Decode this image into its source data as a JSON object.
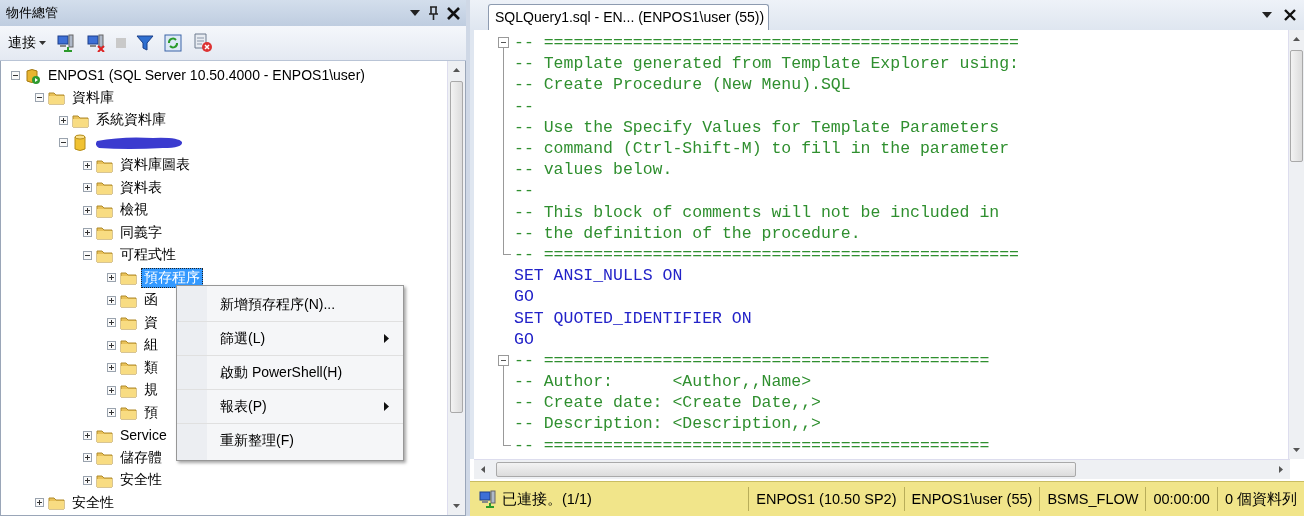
{
  "explorer": {
    "title": "物件總管",
    "toolbar": {
      "connect": "連接"
    },
    "tree": [
      {
        "kind": "server",
        "label": "ENPOS1 (SQL Server 10.50.4000 - ENPOS1\\user)",
        "expanded": true,
        "selected": false,
        "children": [
          {
            "kind": "folder",
            "label": "資料庫",
            "expanded": true,
            "selected": false,
            "children": [
              {
                "kind": "folder",
                "label": "系統資料庫",
                "expanded": false,
                "selected": false
              },
              {
                "kind": "database",
                "redacted": true,
                "expanded": true,
                "selected": false,
                "children": [
                  {
                    "kind": "folder",
                    "label": "資料庫圖表",
                    "expanded": false,
                    "selected": false
                  },
                  {
                    "kind": "folder",
                    "label": "資料表",
                    "expanded": false,
                    "selected": false
                  },
                  {
                    "kind": "folder",
                    "label": "檢視",
                    "expanded": false,
                    "selected": false
                  },
                  {
                    "kind": "folder",
                    "label": "同義字",
                    "expanded": false,
                    "selected": false
                  },
                  {
                    "kind": "folder",
                    "label": "可程式性",
                    "expanded": true,
                    "selected": false,
                    "children": [
                      {
                        "kind": "folder",
                        "label": "預存程序",
                        "expanded": false,
                        "selected": true
                      },
                      {
                        "kind": "folder",
                        "label": "函",
                        "expanded": false,
                        "selected": false
                      },
                      {
                        "kind": "folder",
                        "label": "資",
                        "expanded": false,
                        "selected": false
                      },
                      {
                        "kind": "folder",
                        "label": "組",
                        "expanded": false,
                        "selected": false
                      },
                      {
                        "kind": "folder",
                        "label": "類",
                        "expanded": false,
                        "selected": false
                      },
                      {
                        "kind": "folder",
                        "label": "規",
                        "expanded": false,
                        "selected": false
                      },
                      {
                        "kind": "folder",
                        "label": "預",
                        "expanded": false,
                        "selected": false
                      }
                    ]
                  },
                  {
                    "kind": "folder",
                    "label": "Service",
                    "expanded": false,
                    "selected": false
                  },
                  {
                    "kind": "folder",
                    "label": "儲存體",
                    "expanded": false,
                    "selected": false
                  },
                  {
                    "kind": "folder",
                    "label": "安全性",
                    "expanded": false,
                    "selected": false
                  }
                ]
              }
            ]
          },
          {
            "kind": "folder",
            "label": "安全性",
            "expanded": false,
            "selected": false
          }
        ]
      }
    ]
  },
  "context_menu": {
    "items": [
      {
        "label": "新增預存程序(N)...",
        "submenu": false
      },
      {
        "label": "篩選(L)",
        "submenu": true
      },
      {
        "label": "啟動 PowerShell(H)",
        "submenu": false
      },
      {
        "label": "報表(P)",
        "submenu": true
      },
      {
        "label": "重新整理(F)",
        "submenu": false
      }
    ]
  },
  "editor": {
    "tabs": [
      {
        "label": "SQLQuery1.sql - EN... (ENPOS1\\user (55))",
        "selected": true
      }
    ],
    "blocks": [
      {
        "kind": "region",
        "expanded": true,
        "lines": [
          {
            "kind": "comment",
            "text": "-- ================================================"
          },
          {
            "kind": "comment",
            "text": "-- Template generated from Template Explorer using:"
          },
          {
            "kind": "comment",
            "text": "-- Create Procedure (New Menu).SQL"
          },
          {
            "kind": "comment",
            "text": "--"
          },
          {
            "kind": "comment",
            "text": "-- Use the Specify Values for Template Parameters"
          },
          {
            "kind": "comment",
            "text": "-- command (Ctrl-Shift-M) to fill in the parameter"
          },
          {
            "kind": "comment",
            "text": "-- values below."
          },
          {
            "kind": "comment",
            "text": "--"
          },
          {
            "kind": "comment",
            "text": "-- This block of comments will not be included in"
          },
          {
            "kind": "comment",
            "text": "-- the definition of the procedure."
          },
          {
            "kind": "comment",
            "text": "-- ================================================"
          }
        ]
      },
      {
        "kind": "plain",
        "lines": [
          {
            "kind": "keyword",
            "text": "SET ANSI_NULLS ON"
          },
          {
            "kind": "keyword",
            "text": "GO"
          },
          {
            "kind": "keyword",
            "text": "SET QUOTED_IDENTIFIER ON"
          },
          {
            "kind": "keyword",
            "text": "GO"
          }
        ]
      },
      {
        "kind": "region",
        "expanded": true,
        "lines": [
          {
            "kind": "comment",
            "text": "-- ============================================="
          },
          {
            "kind": "comment",
            "text": "-- Author:      <Author,,Name>"
          },
          {
            "kind": "comment",
            "text": "-- Create date: <Create Date,,>"
          },
          {
            "kind": "comment",
            "text": "-- Description: <Description,,>"
          },
          {
            "kind": "comment",
            "text": "-- ============================================="
          }
        ]
      }
    ]
  },
  "status_bar": {
    "connection": "已連接。(1/1)",
    "cells": [
      "ENPOS1 (10.50 SP2)",
      "ENPOS1\\user (55)",
      "BSMS_FLOW",
      "00:00:00",
      "0 個資料列"
    ]
  }
}
